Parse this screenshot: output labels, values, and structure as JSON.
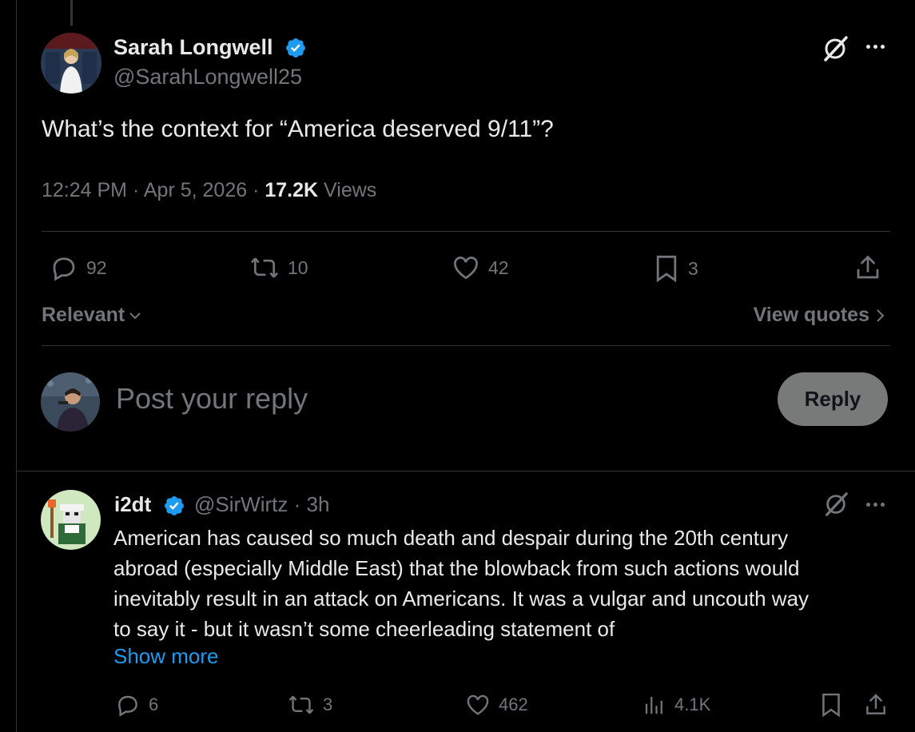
{
  "main_tweet": {
    "author_name": "Sarah Longwell",
    "author_handle": "@SarahLongwell25",
    "text": "What’s the context for “America deserved 9/11”?",
    "time": "12:24 PM",
    "date": "Apr 5, 2026",
    "views_count": "17.2K",
    "views_label": "Views",
    "replies": "92",
    "reposts": "10",
    "likes": "42",
    "bookmarks": "3"
  },
  "sort": {
    "label": "Relevant",
    "view_quotes": "View quotes"
  },
  "composer": {
    "placeholder": "Post your reply",
    "button": "Reply"
  },
  "reply": {
    "author_name": "i2dt",
    "author_handle": "@SirWirtz",
    "age": "3h",
    "lines": [
      "American has caused so much death and despair during the 20th century",
      "abroad (especially Middle East) that the blowback from such actions would",
      "inevitably result in an attack on Americans. It was a vulgar and uncouth way",
      "to say it - but it wasn’t some cheerleading statement of"
    ],
    "show_more": "Show more",
    "replies": "6",
    "reposts": "3",
    "likes": "462",
    "views": "4.1K"
  },
  "colors": {
    "background": "#000000",
    "text": "#e7e9ea",
    "muted": "#71767b",
    "link": "#1d9bf0",
    "verified": "#1d9bf0",
    "divider": "#2f3336"
  }
}
